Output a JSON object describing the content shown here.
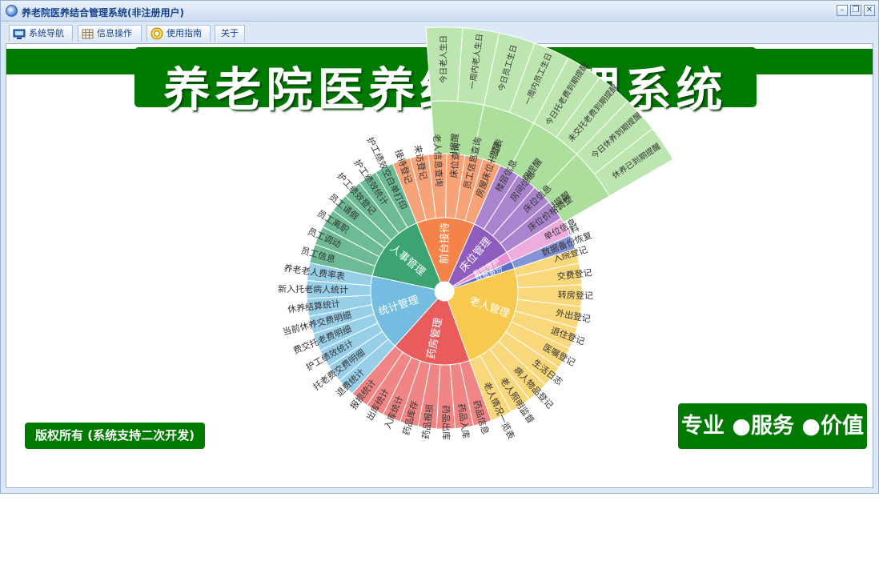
{
  "window": {
    "title": "养老院医养结合管理系统(非注册用户)",
    "controls": [
      "minimize",
      "restore",
      "close"
    ]
  },
  "menu": [
    {
      "label": "系统导航",
      "icon": "monitor-icon"
    },
    {
      "label": "信息操作",
      "icon": "grid-icon"
    },
    {
      "label": "使用指南",
      "icon": "help-icon"
    },
    {
      "label": "关于",
      "icon": ""
    }
  ],
  "banner": {
    "title": "养老院医养结合管理系统"
  },
  "footer": {
    "copyright": "版权所有 (系统支持二次开发)",
    "slogan": "专业 ●服务 ●价值"
  },
  "chart_data": {
    "type": "sunburst",
    "colors": {
      "提醒管理": "#8fd47a",
      "老人管理": "#f7c94f",
      "药房管理": "#ea5c5c",
      "统计管理": "#74bde0",
      "人事管理": "#3ca373",
      "前台接待": "#f4834a",
      "床位管理": "#8e5bbf",
      "系统维护": "#e88fd3",
      "数据备份": "#5a6fc8"
    },
    "categories": [
      {
        "name": "提醒管理",
        "children": [
          {
            "name": "老人生日提醒",
            "children": [
              "今日老人生日",
              "一周内老人生日"
            ]
          },
          {
            "name": "员工生日提醒",
            "children": [
              "今日员工生日",
              "一周内员工生日"
            ]
          },
          {
            "name": "托老费到期提醒",
            "children": [
              "今日托老费到期提醒",
              "未交托老费到期提醒"
            ]
          },
          {
            "name": "休养到期提醒",
            "children": [
              "今日休养到期提醒",
              "休养已到期提醒"
            ]
          }
        ]
      },
      {
        "name": "老人管理",
        "children": [
          {
            "name": "老人资料"
          },
          {
            "name": "入院登记"
          },
          {
            "name": "交费登记"
          },
          {
            "name": "转房登记"
          },
          {
            "name": "外出登记"
          },
          {
            "name": "退住登记"
          },
          {
            "name": "医嘱登记"
          },
          {
            "name": "生活日志"
          },
          {
            "name": "病人物品登记"
          },
          {
            "name": "老人照明监督"
          },
          {
            "name": "老人情况一览表"
          }
        ]
      },
      {
        "name": "药房管理",
        "children": [
          {
            "name": "药品信息"
          },
          {
            "name": "药品入库"
          },
          {
            "name": "药品出库"
          },
          {
            "name": "药品报损"
          },
          {
            "name": "药品库存"
          },
          {
            "name": "入库统计"
          },
          {
            "name": "出库统计"
          },
          {
            "name": "报损统计"
          }
        ]
      },
      {
        "name": "统计管理",
        "children": [
          {
            "name": "退费统计"
          },
          {
            "name": "托老费交费明细"
          },
          {
            "name": "护工绩效统计"
          },
          {
            "name": "费交托老费明细"
          },
          {
            "name": "当前休养交费明细"
          },
          {
            "name": "休养结算统计"
          },
          {
            "name": "新入托老病人统计"
          },
          {
            "name": "养老老人费率表"
          }
        ]
      },
      {
        "name": "人事管理",
        "children": [
          {
            "name": "员工信息"
          },
          {
            "name": "员工调动"
          },
          {
            "name": "员工离职"
          },
          {
            "name": "员工请假"
          },
          {
            "name": "护工绩效登记"
          },
          {
            "name": "护工绩效统计"
          },
          {
            "name": "护工绩效空白单打印"
          }
        ]
      },
      {
        "name": "前台接待",
        "children": [
          {
            "name": "接待登记"
          },
          {
            "name": "来访登记"
          },
          {
            "name": "老人信息查询"
          },
          {
            "name": "床位查询"
          },
          {
            "name": "员工信息查询"
          },
          {
            "name": "房屋床位一览表"
          }
        ]
      },
      {
        "name": "床位管理",
        "children": [
          {
            "name": "楼层信息"
          },
          {
            "name": "房间信息"
          },
          {
            "name": "床位信息"
          },
          {
            "name": "床位价格调整"
          }
        ]
      },
      {
        "name": "系统维护",
        "children": [
          {
            "name": "单位信息"
          }
        ]
      },
      {
        "name": "数据备份",
        "children": [
          {
            "name": "数据备份恢复"
          }
        ]
      }
    ]
  }
}
